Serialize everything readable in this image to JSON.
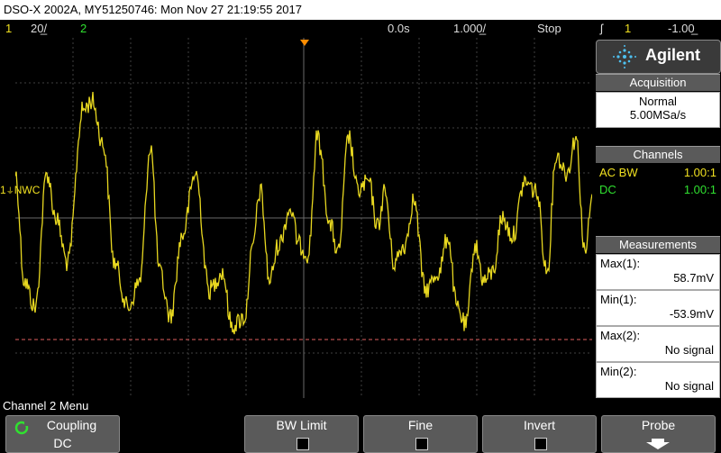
{
  "title": "DSO-X 2002A, MY51250746: Mon Nov 27 21:19:55 2017",
  "status": {
    "ch1_num": "1",
    "ch1_scale": "20̲/",
    "ch2_num": "2",
    "time_offset": "0.0s",
    "timebase": "1.000̲/",
    "run_state": "Stop",
    "trig_icon": "ʃ",
    "trig_channel": "1",
    "trig_level": "-1.00̲"
  },
  "channel_marker": {
    "num": "1",
    "label": "NWC"
  },
  "brand": "Agilent",
  "acquisition": {
    "header": "Acquisition",
    "mode": "Normal",
    "rate": "5.00MSa/s"
  },
  "channels": {
    "header": "Channels",
    "rows": [
      {
        "label": "AC BW",
        "value": "1.00:1",
        "color": "#f0e020"
      },
      {
        "label": "DC",
        "value": "1.00:1",
        "color": "#30e030"
      }
    ]
  },
  "measurements": {
    "header": "Measurements",
    "rows": [
      {
        "label": "Max(1):",
        "value": "58.7mV"
      },
      {
        "label": "Min(1):",
        "value": "-53.9mV"
      },
      {
        "label": "Max(2):",
        "value": "No signal"
      },
      {
        "label": "Min(2):",
        "value": "No signal"
      }
    ]
  },
  "menu_title": "Channel 2 Menu",
  "softkeys": {
    "coupling_label": "Coupling",
    "coupling_value": "DC",
    "bw_limit": "BW Limit",
    "fine": "Fine",
    "invert": "Invert",
    "probe": "Probe"
  },
  "trace_color": "#e8d820",
  "trigger_line_color": "#e06060"
}
